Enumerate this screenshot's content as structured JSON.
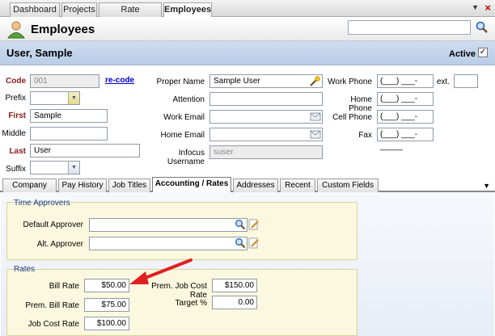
{
  "top_tabs": [
    "Dashboard",
    "Projects",
    "Rate Schedules",
    "Employees"
  ],
  "header": {
    "title": "Employees",
    "search_value": ""
  },
  "record": {
    "name": "User, Sample",
    "active_label": "Active",
    "active_checked": "✓"
  },
  "form": {
    "code_label": "Code",
    "code_value": "001",
    "recode_link": "re-code",
    "prefix_label": "Prefix",
    "prefix_value": "",
    "first_label": "First",
    "first_value": "Sample",
    "middle_label": "Middle",
    "middle_value": "",
    "last_label": "Last",
    "last_value": "User",
    "suffix_label": "Suffix",
    "suffix_value": "",
    "proper_name_label": "Proper Name",
    "proper_name_value": "Sample User",
    "attention_label": "Attention",
    "attention_value": "",
    "work_email_label": "Work Email",
    "work_email_value": "",
    "home_email_label": "Home Email",
    "home_email_value": "",
    "infocus_username_label": "Infocus Username",
    "infocus_username_value": "suser",
    "work_phone_label": "Work Phone",
    "work_phone_value": "(___) ___-_____",
    "ext_label": "ext.",
    "ext_value": "",
    "home_phone_label": "Home Phone",
    "home_phone_value": "(___) ___-_____",
    "cell_phone_label": "Cell Phone",
    "cell_phone_value": "(___) ___-_____",
    "fax_label": "Fax",
    "fax_value": "(___) ___-_____"
  },
  "sub_tabs": [
    "Company",
    "Pay History",
    "Job Titles",
    "Accounting / Rates",
    "Addresses",
    "Recent",
    "Custom Fields"
  ],
  "time_approvers": {
    "title": "Time Approvers",
    "default_label": "Default Approver",
    "default_value": "",
    "alt_label": "Alt. Approver",
    "alt_value": ""
  },
  "rates": {
    "title": "Rates",
    "bill_rate_label": "Bill Rate",
    "bill_rate_value": "$50.00",
    "prem_bill_rate_label": "Prem. Bill Rate",
    "prem_bill_rate_value": "$75.00",
    "job_cost_rate_label": "Job Cost Rate",
    "job_cost_rate_value": "$100.00",
    "prem_job_cost_rate_label": "Prem. Job Cost Rate",
    "prem_job_cost_rate_value": "$150.00",
    "target_label": "Target %",
    "target_value": "0.00"
  },
  "colors": {
    "header_bar": "#c6d6ec",
    "group_bg": "#fbf8df",
    "required_label": "#8b1a1a",
    "arrow": "#e02020"
  }
}
